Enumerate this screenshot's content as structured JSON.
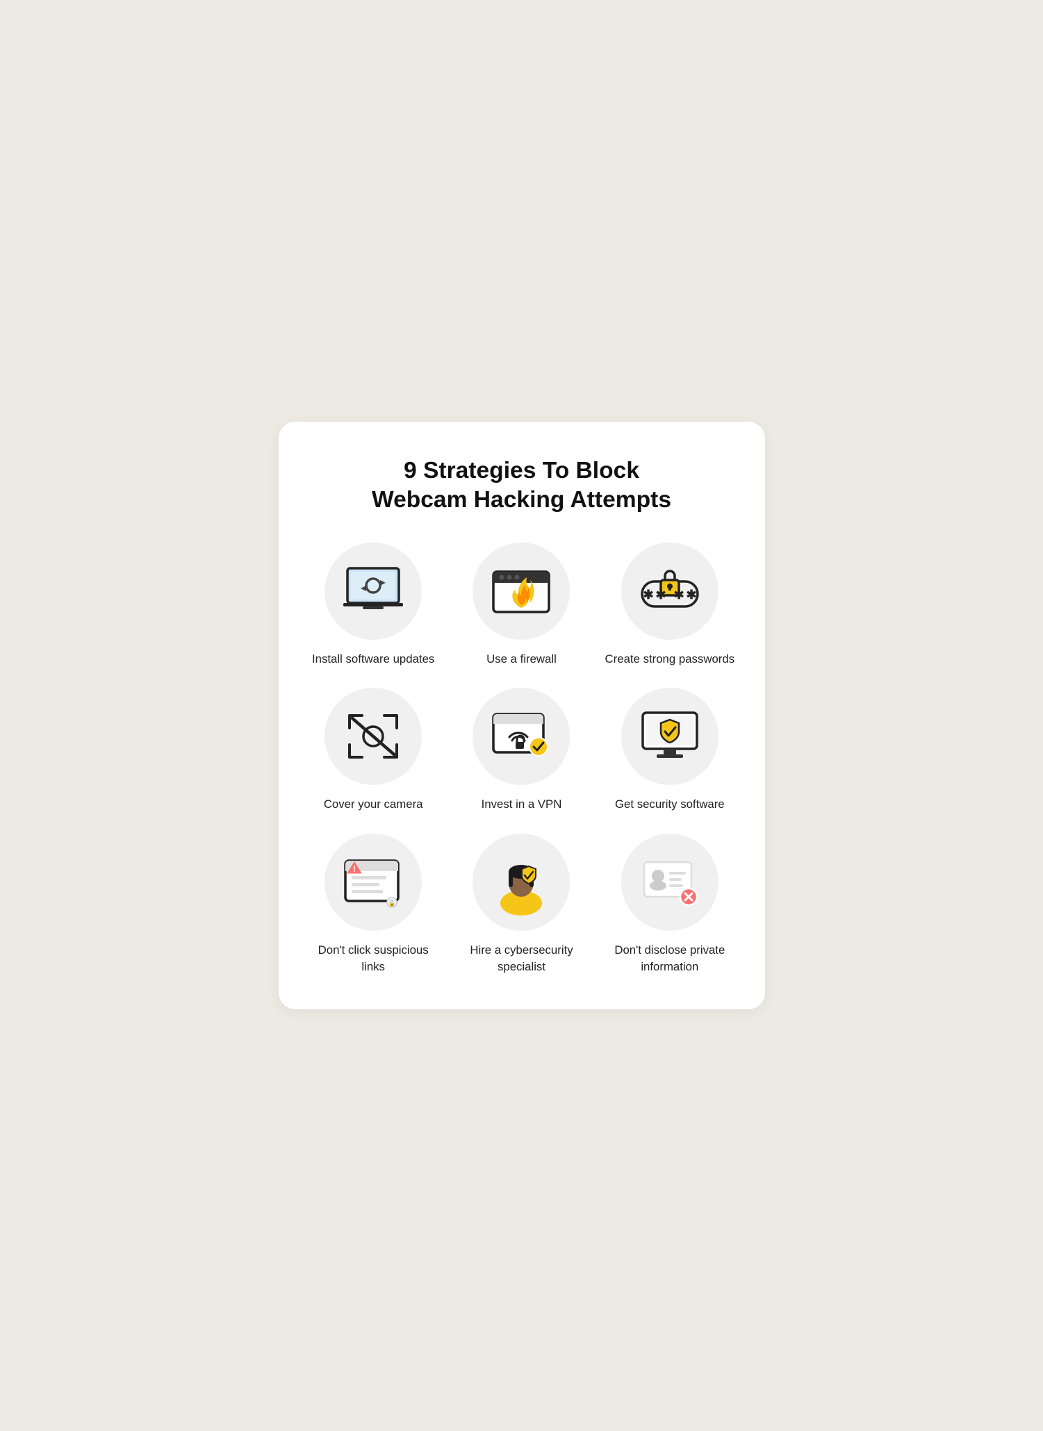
{
  "page": {
    "title": "9 Strategies To Block\nWebcam Hacking Attempts",
    "bg_color": "#ede9e3",
    "card_color": "#ffffff"
  },
  "items": [
    {
      "id": "install-updates",
      "label": "Install software updates",
      "icon": "laptop-refresh"
    },
    {
      "id": "use-firewall",
      "label": "Use a firewall",
      "icon": "firewall"
    },
    {
      "id": "strong-passwords",
      "label": "Create strong passwords",
      "icon": "password"
    },
    {
      "id": "cover-camera",
      "label": "Cover your camera",
      "icon": "camera-off"
    },
    {
      "id": "vpn",
      "label": "Invest in a VPN",
      "icon": "vpn"
    },
    {
      "id": "security-software",
      "label": "Get security software",
      "icon": "security-monitor"
    },
    {
      "id": "suspicious-links",
      "label": "Don't click suspicious links",
      "icon": "suspicious-link"
    },
    {
      "id": "cybersecurity-specialist",
      "label": "Hire a cybersecurity specialist",
      "icon": "specialist"
    },
    {
      "id": "private-info",
      "label": "Don't disclose private information",
      "icon": "private-info"
    }
  ]
}
